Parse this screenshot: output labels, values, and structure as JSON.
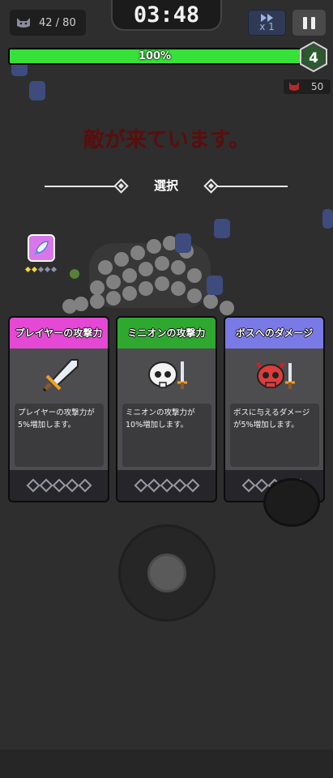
{
  "hud": {
    "kill_count": "42 / 80",
    "timer": "03:48",
    "speed_label": "x 1",
    "boss_count": "50"
  },
  "player": {
    "hp_percent": 100,
    "hp_label": "100%",
    "level": "4"
  },
  "banner": {
    "warning": "敵が来ています。",
    "select_label": "選択"
  },
  "skill": {
    "icon": "rocket-icon",
    "level": 2,
    "max_level": 5
  },
  "cards": [
    {
      "title": "プレイヤーの攻撃力",
      "description": "プレイヤーの攻撃力が5%増加します。",
      "icon": "sword-icon",
      "header_color": "#e448d4",
      "stars": 0,
      "max_stars": 5
    },
    {
      "title": "ミニオンの攻撃力",
      "description": "ミニオンの攻撃力が10%増加します。",
      "icon": "skull-sword-icon",
      "header_color": "#2fa82f",
      "stars": 0,
      "max_stars": 5
    },
    {
      "title": "ボスへのダメージ",
      "description": "ボスに与えるダメージが5%増加します。",
      "icon": "demon-skull-sword-icon",
      "header_color": "#7a7ae6",
      "stars": 0,
      "max_stars": 5
    }
  ]
}
